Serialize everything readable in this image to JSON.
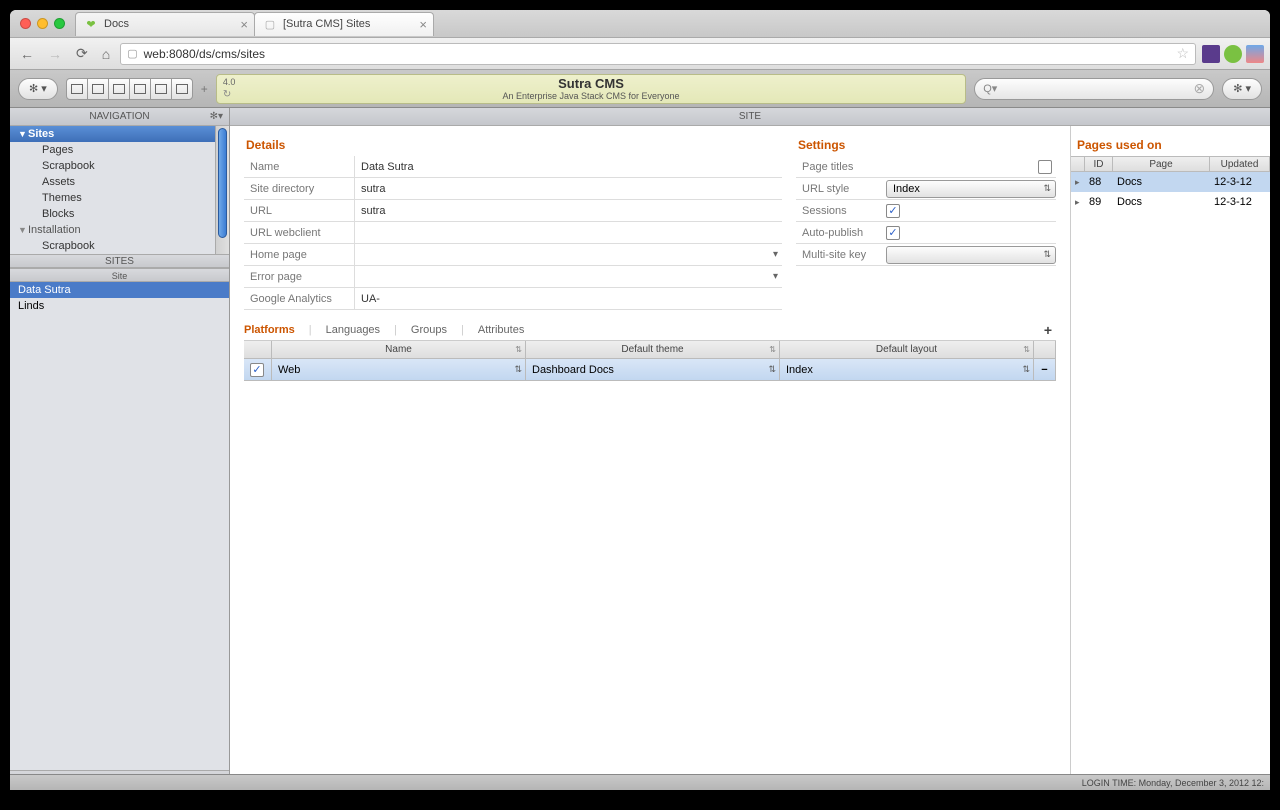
{
  "browser": {
    "tabs": [
      {
        "title": "Docs"
      },
      {
        "title": "[Sutra CMS] Sites"
      }
    ],
    "url": "web:8080/ds/cms/sites"
  },
  "banner": {
    "version": "4.0",
    "title": "Sutra CMS",
    "subtitle": "An Enterprise Java Stack CMS for Everyone"
  },
  "sidebar": {
    "nav_title": "NAVIGATION",
    "tree": {
      "sites_label": "Sites",
      "items": [
        "Pages",
        "Scrapbook",
        "Assets",
        "Themes",
        "Blocks"
      ],
      "installation_label": "Installation",
      "installation_items": [
        "Scrapbook"
      ]
    },
    "sites_divider": "SITES",
    "site_divider": "Site",
    "sites": [
      "Data Sutra",
      "Linds"
    ]
  },
  "main": {
    "header": "SITE",
    "details": {
      "title": "Details",
      "rows": {
        "name_label": "Name",
        "name_value": "Data Sutra",
        "dir_label": "Site directory",
        "dir_value": "sutra",
        "url_label": "URL",
        "url_value": "sutra",
        "urlwc_label": "URL webclient",
        "urlwc_value": "",
        "home_label": "Home page",
        "home_value": "",
        "error_label": "Error page",
        "error_value": "",
        "ga_label": "Google Analytics",
        "ga_value": "UA-"
      }
    },
    "settings": {
      "title": "Settings",
      "page_titles_label": "Page titles",
      "url_style_label": "URL style",
      "url_style_value": "Index",
      "sessions_label": "Sessions",
      "autopublish_label": "Auto-publish",
      "multisite_label": "Multi-site key"
    },
    "pages_used": {
      "title": "Pages used on",
      "cols": {
        "id": "ID",
        "page": "Page",
        "updated": "Updated"
      },
      "rows": [
        {
          "id": "88",
          "page": "Docs",
          "updated": "12-3-12"
        },
        {
          "id": "89",
          "page": "Docs",
          "updated": "12-3-12"
        }
      ]
    },
    "platforms": {
      "tabs": [
        "Platforms",
        "Languages",
        "Groups",
        "Attributes"
      ],
      "cols": {
        "name": "Name",
        "theme": "Default theme",
        "layout": "Default layout"
      },
      "row": {
        "name": "Web",
        "theme": "Dashboard Docs",
        "layout": "Index"
      }
    }
  },
  "status": "LOGIN TIME: Monday, December 3, 2012 12:"
}
